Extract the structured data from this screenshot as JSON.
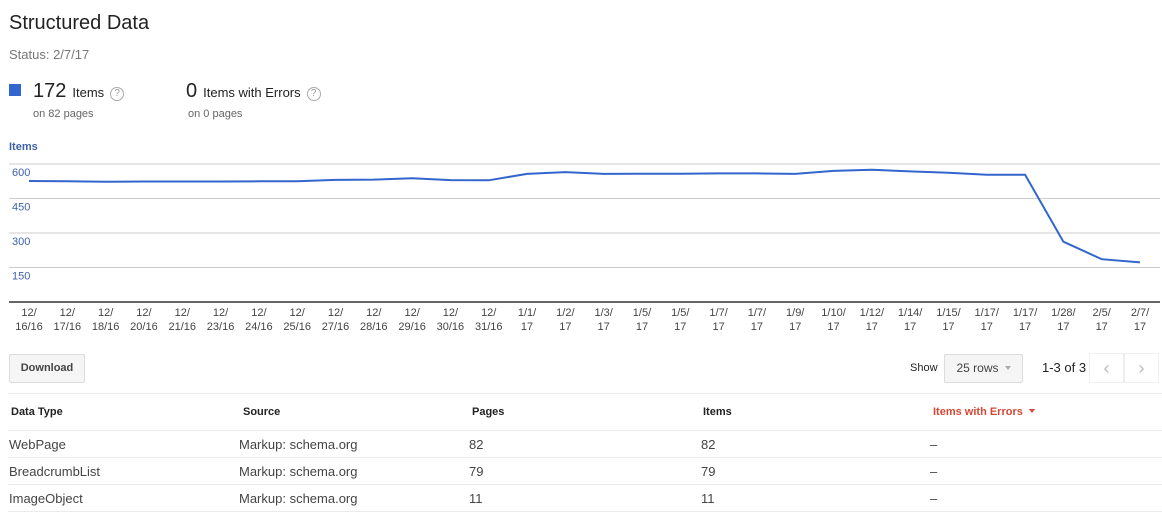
{
  "header": {
    "title": "Structured Data",
    "status": "Status: 2/7/17"
  },
  "summary": {
    "items": {
      "count": "172",
      "label": "Items",
      "sub": "on 82 pages",
      "color": "#3366cc"
    },
    "errors": {
      "count": "0",
      "label": "Items with Errors",
      "sub": "on 0 pages"
    },
    "help_glyph": "?"
  },
  "chart_data": {
    "type": "line",
    "title": "Items",
    "xlabel": "",
    "ylabel": "Items",
    "ylim": [
      0,
      600
    ],
    "yticks": [
      150,
      300,
      450,
      600
    ],
    "grid": true,
    "legend": "none",
    "color": "#3366cc",
    "categories": [
      "12/16/16",
      "12/17/16",
      "12/18/16",
      "12/20/16",
      "12/21/16",
      "12/23/16",
      "12/24/16",
      "12/25/16",
      "12/27/16",
      "12/28/16",
      "12/29/16",
      "12/30/16",
      "12/31/16",
      "1/1/17",
      "1/2/17",
      "1/3/17",
      "1/5/17",
      "1/5/17",
      "1/7/17",
      "1/7/17",
      "1/9/17",
      "1/10/17",
      "1/12/17",
      "1/14/17",
      "1/15/17",
      "1/17/17",
      "1/17/17",
      "1/28/17",
      "2/5/17",
      "2/7/17"
    ],
    "tick_labels": [
      [
        "12/",
        "16/16"
      ],
      [
        "12/",
        "17/16"
      ],
      [
        "12/",
        "18/16"
      ],
      [
        "12/",
        "20/16"
      ],
      [
        "12/",
        "21/16"
      ],
      [
        "12/",
        "23/16"
      ],
      [
        "12/",
        "24/16"
      ],
      [
        "12/",
        "25/16"
      ],
      [
        "12/",
        "27/16"
      ],
      [
        "12/",
        "28/16"
      ],
      [
        "12/",
        "29/16"
      ],
      [
        "12/",
        "30/16"
      ],
      [
        "12/",
        "31/16"
      ],
      [
        "1/1/",
        "17"
      ],
      [
        "1/2/",
        "17"
      ],
      [
        "1/3/",
        "17"
      ],
      [
        "1/5/",
        "17"
      ],
      [
        "1/5/",
        "17"
      ],
      [
        "1/7/",
        "17"
      ],
      [
        "1/7/",
        "17"
      ],
      [
        "1/9/",
        "17"
      ],
      [
        "1/10/",
        "17"
      ],
      [
        "1/12/",
        "17"
      ],
      [
        "1/14/",
        "17"
      ],
      [
        "1/15/",
        "17"
      ],
      [
        "1/17/",
        "17"
      ],
      [
        "1/17/",
        "17"
      ],
      [
        "1/28/",
        "17"
      ],
      [
        "2/5/",
        "17"
      ],
      [
        "2/7/",
        "17"
      ]
    ],
    "values": [
      526,
      525,
      523,
      524,
      524,
      524,
      525,
      525,
      531,
      532,
      538,
      530,
      529,
      557,
      565,
      557,
      558,
      558,
      559,
      559,
      557,
      570,
      575,
      568,
      562,
      553,
      553,
      262,
      186,
      172
    ]
  },
  "toolbar": {
    "download_label": "Download",
    "show_label": "Show",
    "rows_value": "25 rows",
    "page_info": "1-3 of 3",
    "prev_glyph": "‹",
    "next_glyph": "›"
  },
  "table": {
    "columns": [
      "Data Type",
      "Source",
      "Pages",
      "Items",
      "Items with Errors"
    ],
    "rows": [
      [
        "WebPage",
        "Markup: schema.org",
        "82",
        "82",
        "–"
      ],
      [
        "BreadcrumbList",
        "Markup: schema.org",
        "79",
        "79",
        "–"
      ],
      [
        "ImageObject",
        "Markup: schema.org",
        "11",
        "11",
        "–"
      ]
    ]
  }
}
